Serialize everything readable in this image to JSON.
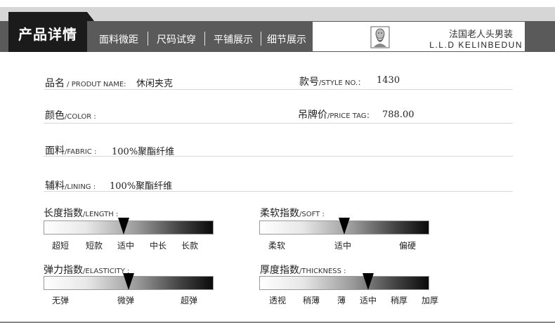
{
  "header": {
    "title": "产品详情",
    "nav": [
      "面料微距",
      "尺码试穿",
      "平铺展示",
      "细节展示"
    ],
    "brand_cn": "法国老人头男装",
    "brand_en": "L.L.D KELINBEDUN",
    "logo_icon": "old-man-head-logo"
  },
  "fields": {
    "name_label": "品名",
    "name_label_en": " / PRODUT NAME:",
    "name_value": "休闲夹克",
    "style_label": "款号",
    "style_label_en": "/STYLE NO.：",
    "style_value": "1430",
    "color_label": "颜色",
    "color_label_en": "/COLOR :",
    "price_label": "吊牌价",
    "price_label_en": "/PRICE TAG：",
    "price_value": "788.00",
    "fabric_label": "面料",
    "fabric_label_en": "/FABRIC :",
    "fabric_value": "100%聚酯纤维",
    "lining_label": "辅料",
    "lining_label_en": "/LINING :",
    "lining_value": "100%聚酯纤维"
  },
  "scales": {
    "length": {
      "label": "长度指数",
      "label_en": "/LENGTH :",
      "ticks": [
        "超短",
        "短款",
        "适中",
        "中长",
        "长款"
      ],
      "level": 0.47
    },
    "soft": {
      "label": "柔软指数",
      "label_en": "/SOFT :",
      "ticks": [
        "柔软",
        "适中",
        "偏硬"
      ],
      "level": 0.5
    },
    "elasticity": {
      "label": "弹力指数",
      "label_en": "/ELASTICITY :",
      "ticks": [
        "无弹",
        "微弹",
        "超弹"
      ],
      "level": 0.5
    },
    "thickness": {
      "label": "厚度指数",
      "label_en": "/THICKNESS :",
      "ticks": [
        "透视",
        "稍薄",
        "薄",
        "适中",
        "稍厚",
        "加厚"
      ],
      "level": 0.64
    }
  },
  "colors": {
    "header_bar": "#5a5a5a",
    "active_tab": "#1b1b1b",
    "pointer": "#000000"
  }
}
